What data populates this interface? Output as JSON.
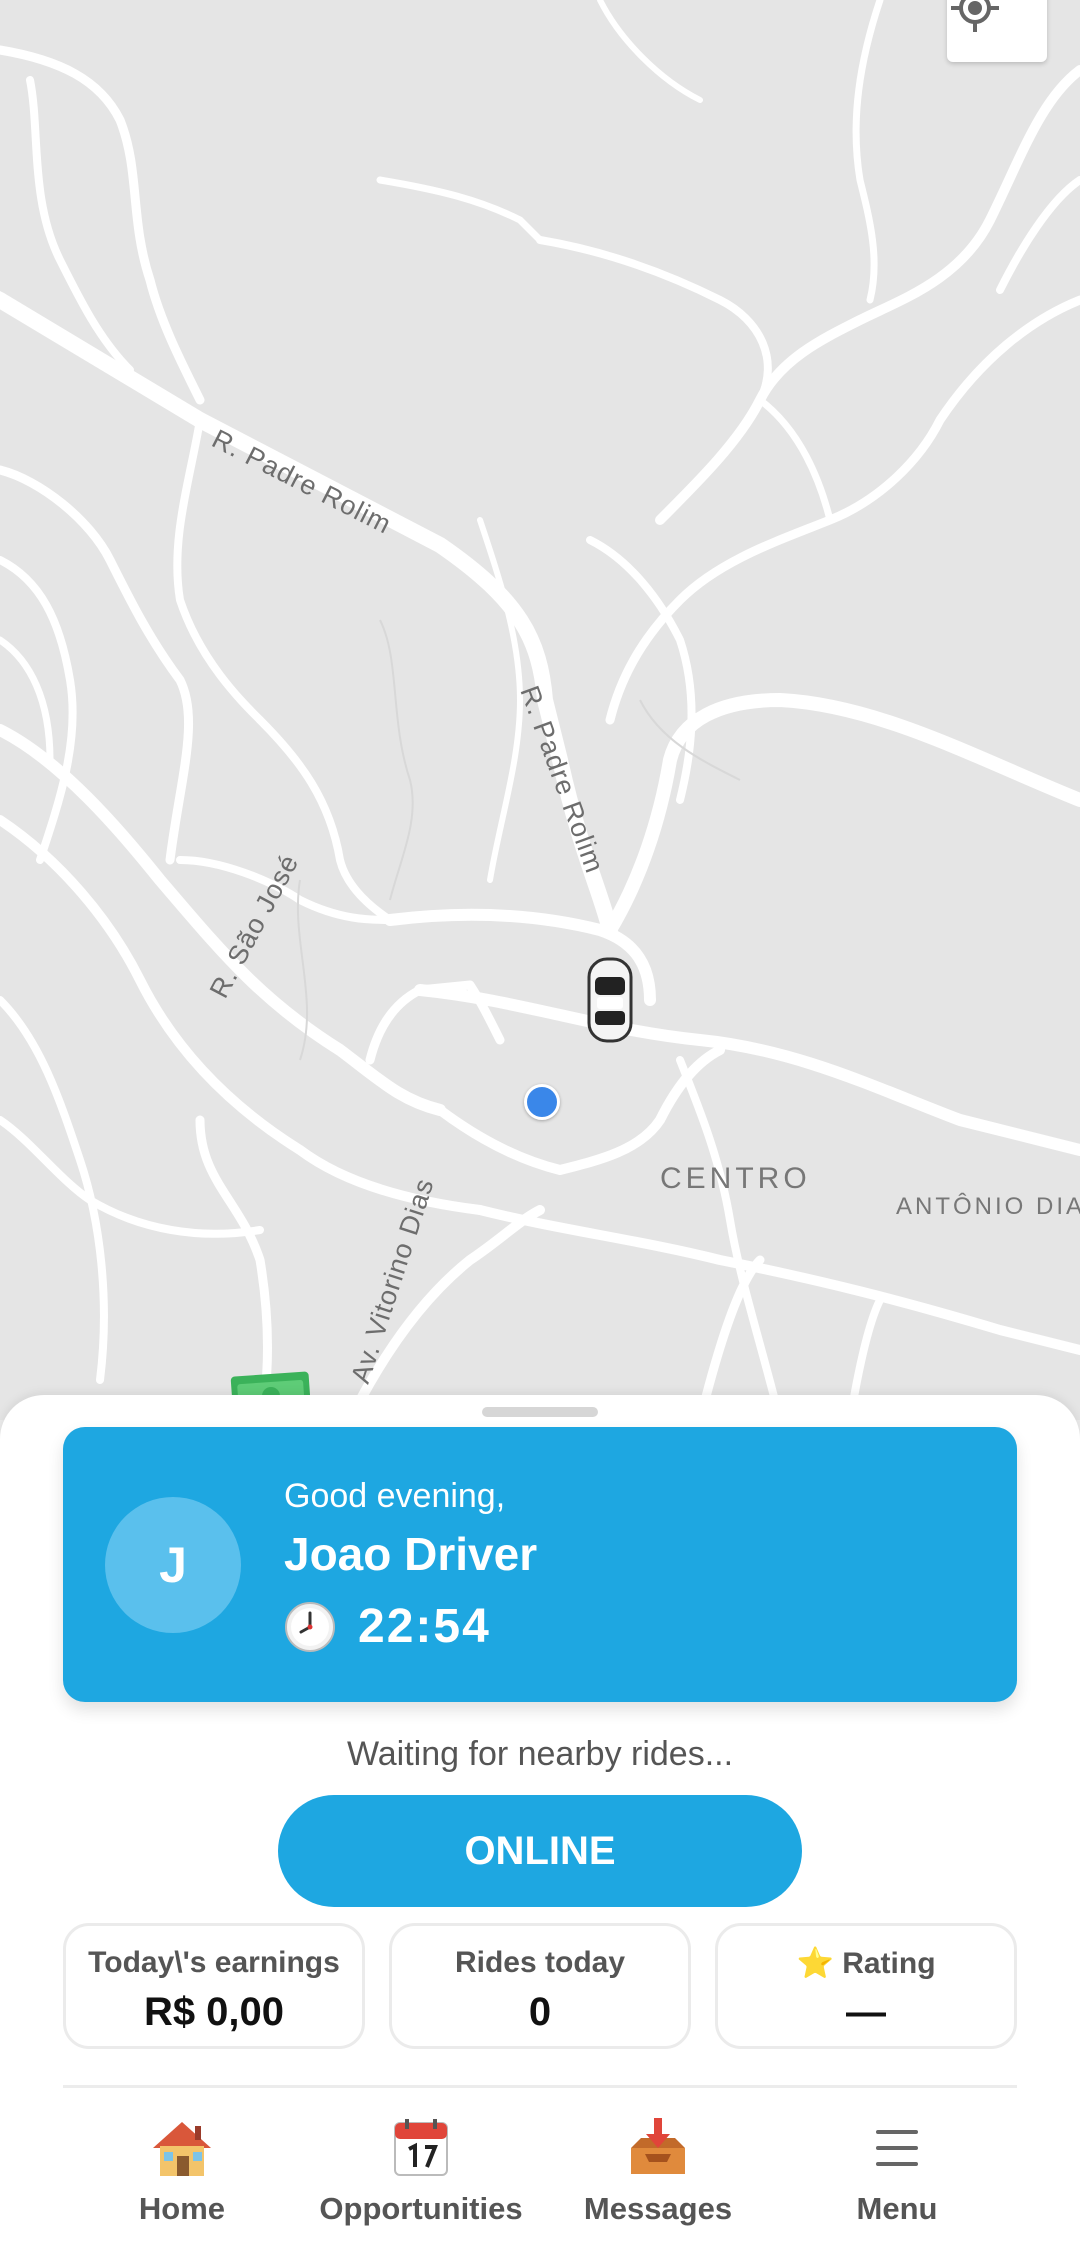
{
  "map": {
    "street_labels": [
      "R. Padre Rolim",
      "R. Padre Rolim",
      "R. São José",
      "Av. Vitorino Dias"
    ],
    "area_labels": [
      "CENTRO",
      "ANTÔNIO DIA"
    ],
    "locate_icon": "crosshair-icon",
    "car_icon": "car-icon",
    "money_icon": "money-icon"
  },
  "driver_card": {
    "avatar_initial": "J",
    "greeting": "Good evening,",
    "name": "Joao Driver",
    "clock_icon": "🕐",
    "time": "22:54",
    "color": "#1ea7e1"
  },
  "status": {
    "waiting_text": "Waiting for nearby rides...",
    "toggle_label": "ONLINE"
  },
  "stats": {
    "earnings_label": "Today\\'s earnings",
    "earnings_value": "R$ 0,00",
    "rides_label": "Rides today",
    "rides_value": "0",
    "rating_icon": "⭐",
    "rating_label": "Rating",
    "rating_value": "—"
  },
  "bottom_nav": {
    "items": [
      {
        "label": "Home",
        "icon": "house-icon"
      },
      {
        "label": "Opportunities",
        "icon": "calendar-icon"
      },
      {
        "label": "Messages",
        "icon": "inbox-icon"
      },
      {
        "label": "Menu",
        "icon": "hamburger-icon"
      }
    ]
  }
}
